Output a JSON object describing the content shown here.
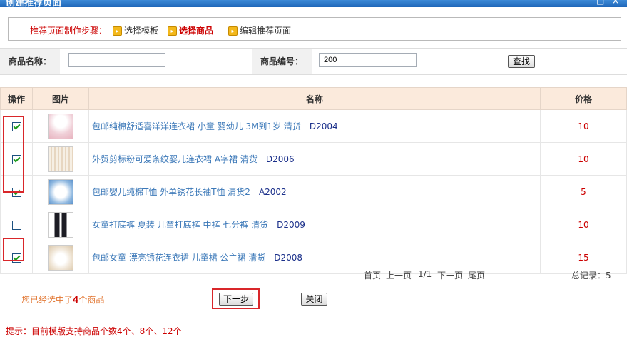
{
  "window": {
    "title": "创建推荐页面"
  },
  "steps": {
    "lead": "推荐页面制作步骤：",
    "items": [
      {
        "label": "选择模板",
        "active": false
      },
      {
        "label": "选择商品",
        "active": true
      },
      {
        "label": "编辑推荐页面",
        "active": false
      }
    ]
  },
  "search": {
    "name_label": "商品名称：",
    "name_value": "",
    "code_label": "商品编号：",
    "code_value": "200",
    "button": "查找"
  },
  "table": {
    "headers": [
      "操作",
      "图片",
      "名称",
      "价格"
    ],
    "rows": [
      {
        "checked": true,
        "name": "包邮纯棉舒适喜洋洋连衣裙 小童 婴幼儿 3M到1岁 清货",
        "code": "D2004",
        "price": "10"
      },
      {
        "checked": true,
        "name": "外贸剪标粉可爱条纹婴儿连衣裙 A字裙 清货",
        "code": "D2006",
        "price": "10"
      },
      {
        "checked": true,
        "name": "包邮婴儿纯棉T恤 外单锈花长袖T恤 清货2",
        "code": "A2002",
        "price": "5"
      },
      {
        "checked": false,
        "name": "女童打底裤 夏装 儿童打底裤 中裤 七分裤 清货",
        "code": "D2009",
        "price": "10"
      },
      {
        "checked": true,
        "name": "包邮女童 漂亮锈花连衣裙 儿童裙 公主裙 清货",
        "code": "D2008",
        "price": "15"
      }
    ]
  },
  "pager": {
    "first": "首页",
    "prev": "上一页",
    "page": "1/1",
    "next": "下一页",
    "last": "尾页",
    "total": "总记录：5"
  },
  "footer": {
    "selected_pre": "您已经选中了",
    "selected_count": "4",
    "selected_post": "个商品",
    "next_button": "下一步",
    "close_button": "关闭",
    "hint": "提示：目前模版支持商品个数4个、8个、12个"
  },
  "colors": {
    "accent_red": "#cc0000",
    "header_bg": "#fbeadc",
    "link_blue": "#3b78b8"
  }
}
